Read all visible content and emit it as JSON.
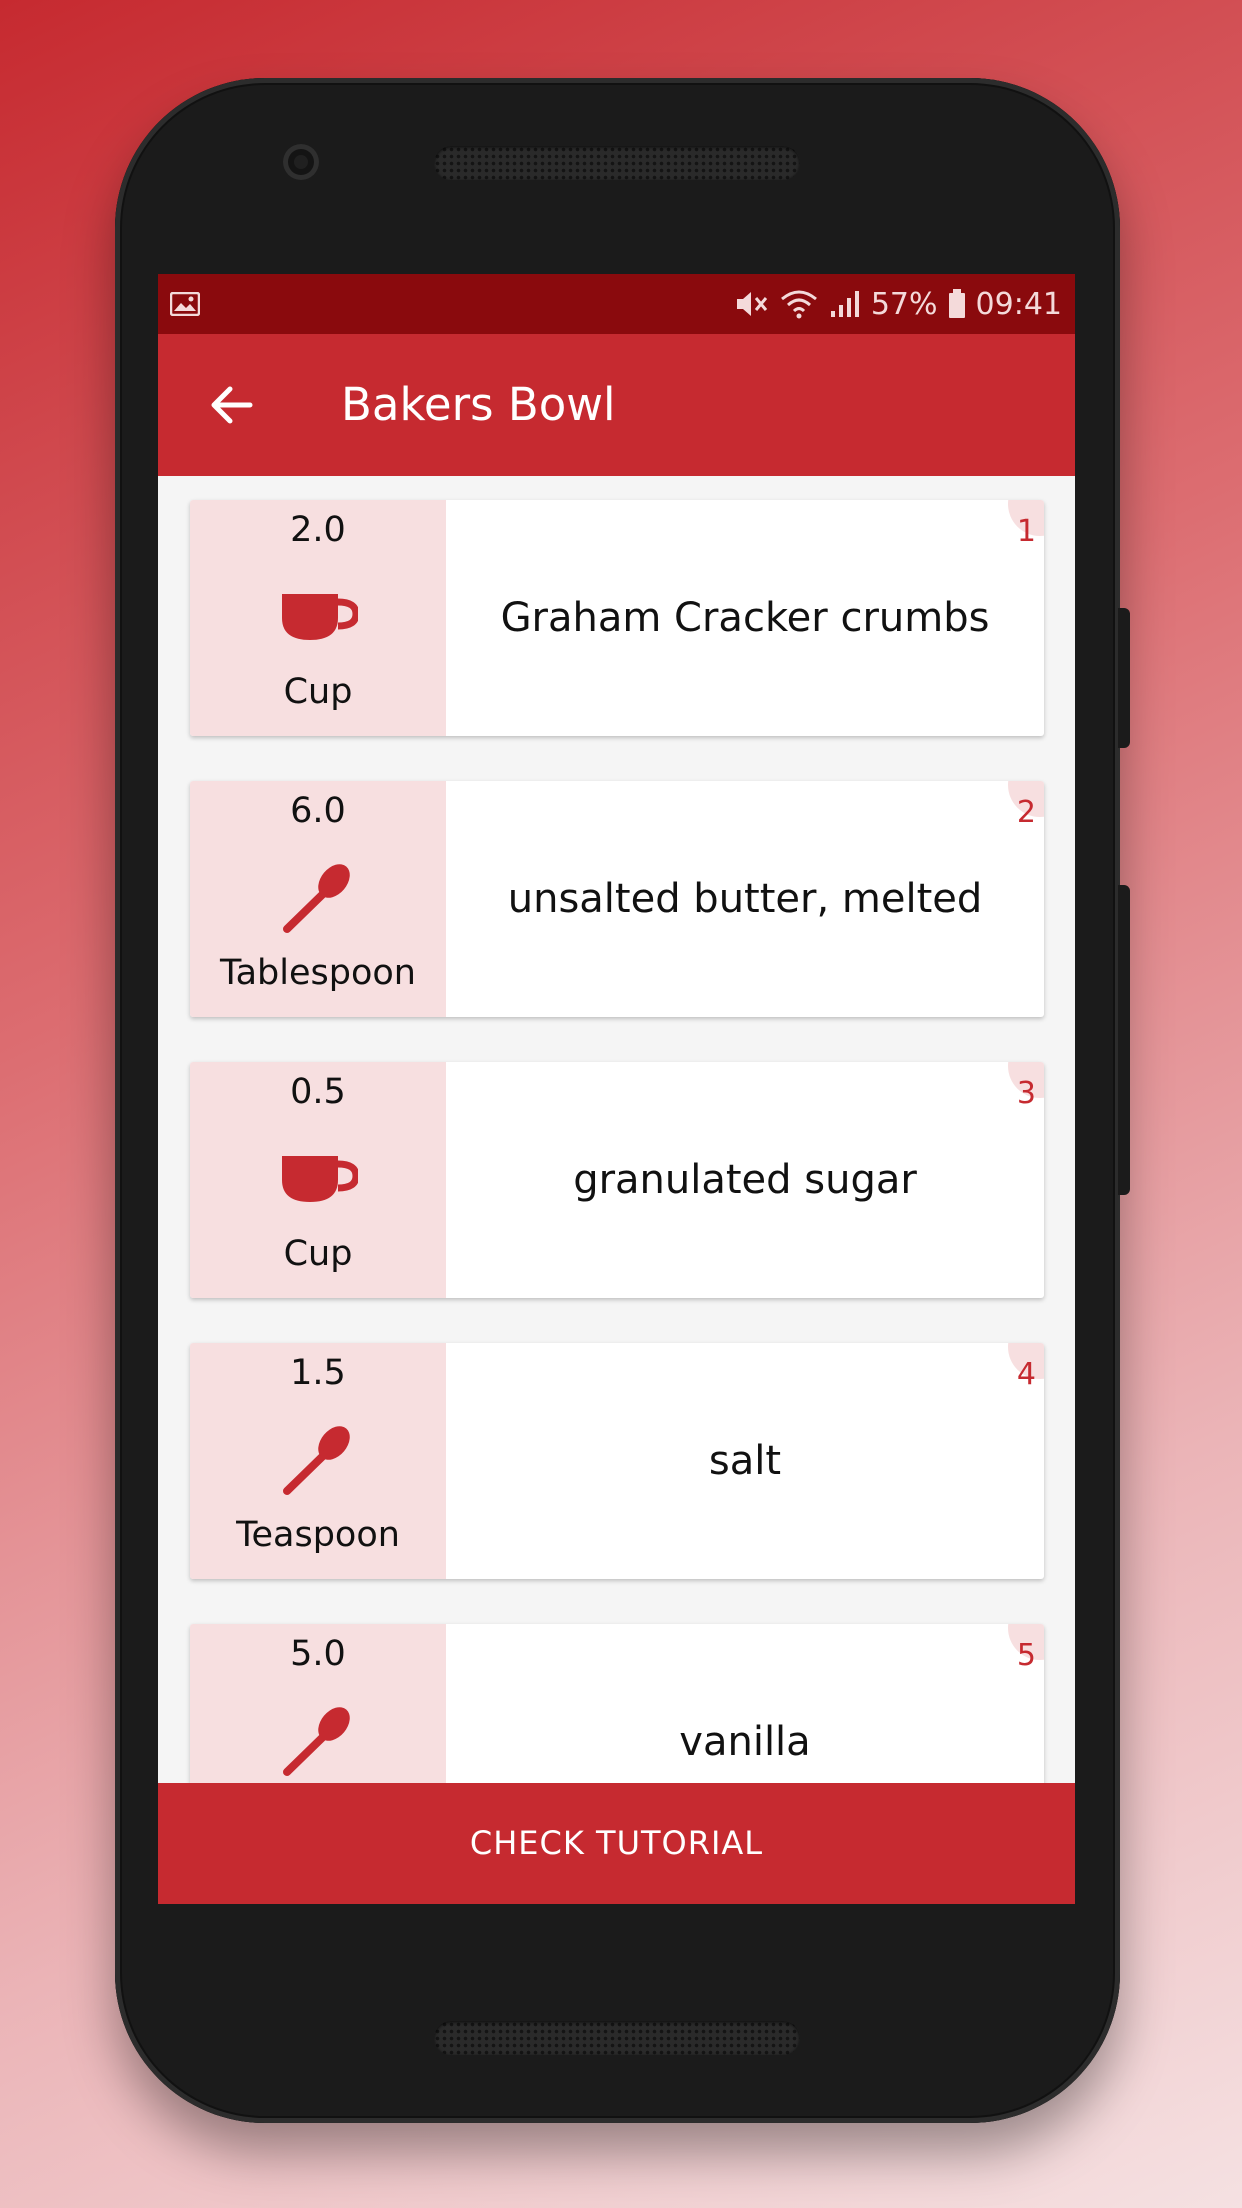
{
  "status_bar": {
    "battery": "57%",
    "time": "09:41"
  },
  "app_bar": {
    "title": "Bakers Bowl"
  },
  "ingredients": [
    {
      "index": "1",
      "quantity": "2.0",
      "unit": "Cup",
      "unit_icon": "cup-icon",
      "name": "Graham Cracker crumbs"
    },
    {
      "index": "2",
      "quantity": "6.0",
      "unit": "Tablespoon",
      "unit_icon": "spoon-icon",
      "name": "unsalted butter, melted"
    },
    {
      "index": "3",
      "quantity": "0.5",
      "unit": "Cup",
      "unit_icon": "cup-icon",
      "name": "granulated sugar"
    },
    {
      "index": "4",
      "quantity": "1.5",
      "unit": "Teaspoon",
      "unit_icon": "spoon-icon",
      "name": "salt"
    },
    {
      "index": "5",
      "quantity": "5.0",
      "unit": "",
      "unit_icon": "spoon-icon",
      "name": "vanilla"
    }
  ],
  "footer": {
    "check_tutorial_label": "CHECK TUTORIAL"
  },
  "colors": {
    "primary": "#c62a30",
    "status_bar": "#8a0a0d",
    "unit_panel": "#f7dfe0"
  }
}
